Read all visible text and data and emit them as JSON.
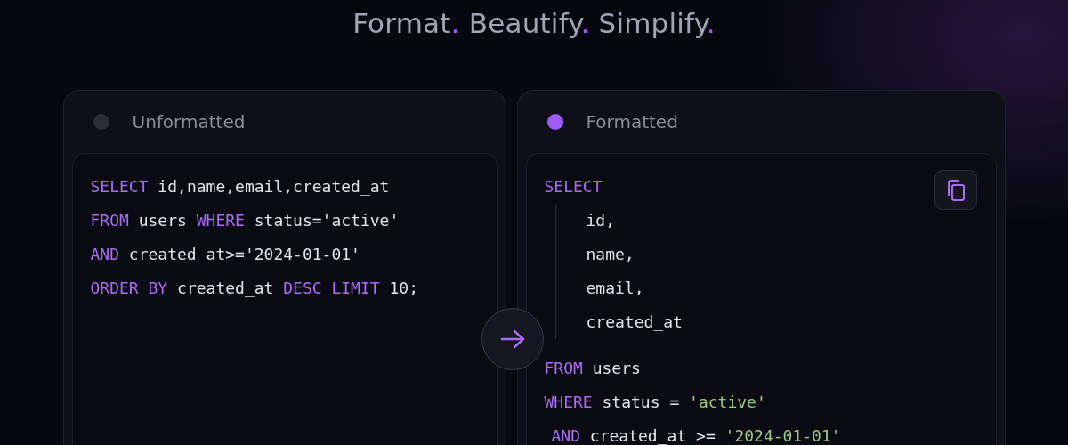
{
  "headline": [
    {
      "text": "Format",
      "accent": "."
    },
    {
      "text": "Beautify",
      "accent": "."
    },
    {
      "text": "Simplify",
      "accent": "."
    }
  ],
  "panels": [
    {
      "title": "Unformatted",
      "active": false,
      "copy_button": false,
      "lines": [
        {
          "kind": "top",
          "tokens": [
            {
              "kind": "keyword",
              "text": "SELECT"
            },
            {
              "kind": "text",
              "text": " id,name,email,created_at"
            }
          ]
        },
        {
          "kind": "top",
          "tokens": [
            {
              "kind": "keyword",
              "text": "FROM"
            },
            {
              "kind": "text",
              "text": " users "
            },
            {
              "kind": "keyword",
              "text": "WHERE"
            },
            {
              "kind": "text",
              "text": " status='active'"
            }
          ]
        },
        {
          "kind": "top",
          "tokens": [
            {
              "kind": "keyword",
              "text": "AND"
            },
            {
              "kind": "text",
              "text": " created_at>='2024-01-01'"
            }
          ]
        },
        {
          "kind": "top",
          "tokens": [
            {
              "kind": "keyword",
              "text": "ORDER BY"
            },
            {
              "kind": "text",
              "text": " created_at "
            },
            {
              "kind": "keyword",
              "text": "DESC LIMIT"
            },
            {
              "kind": "text",
              "text": " 10;"
            }
          ]
        }
      ]
    },
    {
      "title": "Formatted",
      "active": true,
      "copy_button": true,
      "lines": [
        {
          "kind": "top",
          "tokens": [
            {
              "kind": "keyword",
              "text": "SELECT"
            }
          ]
        },
        {
          "kind": "indented",
          "tokens": [
            {
              "kind": "text",
              "text": "id,"
            }
          ]
        },
        {
          "kind": "indented",
          "tokens": [
            {
              "kind": "text",
              "text": "name,"
            }
          ]
        },
        {
          "kind": "indented",
          "tokens": [
            {
              "kind": "text",
              "text": "email,"
            }
          ]
        },
        {
          "kind": "indented",
          "tokens": [
            {
              "kind": "text",
              "text": "created_at"
            }
          ]
        },
        {
          "kind": "top",
          "tokens": [
            {
              "kind": "keyword",
              "text": "FROM"
            },
            {
              "kind": "text",
              "text": " users"
            }
          ]
        },
        {
          "kind": "top",
          "tokens": [
            {
              "kind": "keyword",
              "text": "WHERE"
            },
            {
              "kind": "text",
              "text": " status = "
            },
            {
              "kind": "string",
              "text": "'active'"
            }
          ]
        },
        {
          "kind": "sub",
          "tokens": [
            {
              "kind": "keyword",
              "text": "AND"
            },
            {
              "kind": "text",
              "text": " created_at >= "
            },
            {
              "kind": "string",
              "text": "'2024-01-01'"
            }
          ]
        }
      ]
    }
  ]
}
